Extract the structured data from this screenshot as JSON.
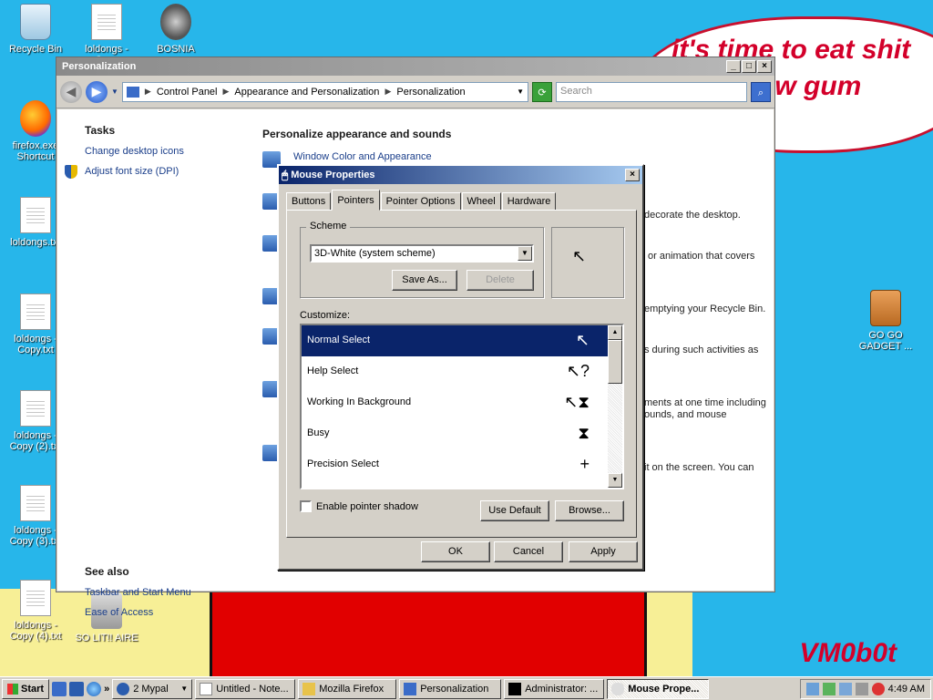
{
  "wallpaper": {
    "speech_text": "it's time to eat shit and chew gum",
    "signature": "VM0b0t"
  },
  "desktop_icons": [
    {
      "label": "Recycle Bin"
    },
    {
      "label": "loldongs - Copy"
    },
    {
      "label": "BOSNIA"
    },
    {
      "label": "firefox.exe Shortcut"
    },
    {
      "label": "loldongs.txt"
    },
    {
      "label": "loldongs - Copy.txt"
    },
    {
      "label": "loldongs - Copy (2).txt"
    },
    {
      "label": "loldongs - Copy (3).txt"
    },
    {
      "label": "loldongs - Copy (4).txt"
    },
    {
      "label": "SO LIT!! AIRE"
    },
    {
      "label": "GO GO GADGET ..."
    }
  ],
  "personalization": {
    "title": "Personalization",
    "breadcrumb": [
      "Control Panel",
      "Appearance and Personalization",
      "Personalization"
    ],
    "search_placeholder": "Search",
    "tasks_heading": "Tasks",
    "tasks": [
      "Change desktop icons",
      "Adjust font size (DPI)"
    ],
    "see_also_heading": "See also",
    "see_also": [
      "Taskbar and Start Menu",
      "Ease of Access"
    ],
    "main_heading": "Personalize appearance and sounds",
    "first_item": "Window Color and Appearance",
    "fragments": [
      "decorate the desktop.",
      "or animation that covers",
      "emptying your Recycle Bin.",
      "s during such activities as",
      "ments at one time including",
      "ounds, and mouse",
      "it on the screen. You can"
    ]
  },
  "mouse_dialog": {
    "title": "Mouse Properties",
    "tabs": [
      "Buttons",
      "Pointers",
      "Pointer Options",
      "Wheel",
      "Hardware"
    ],
    "scheme_label": "Scheme",
    "scheme_value": "3D-White (system scheme)",
    "save_as": "Save As...",
    "delete": "Delete",
    "customize_label": "Customize:",
    "pointers": [
      {
        "name": "Normal Select",
        "cursor": "↖"
      },
      {
        "name": "Help Select",
        "cursor": "↖?"
      },
      {
        "name": "Working In Background",
        "cursor": "↖⧗"
      },
      {
        "name": "Busy",
        "cursor": "⧗"
      },
      {
        "name": "Precision Select",
        "cursor": "+"
      }
    ],
    "shadow_label": "Enable pointer shadow",
    "use_default": "Use Default",
    "browse": "Browse...",
    "ok": "OK",
    "cancel": "Cancel",
    "apply": "Apply"
  },
  "taskbar": {
    "start": "Start",
    "buttons": [
      {
        "label": "2 Mypal"
      },
      {
        "label": "Untitled - Note..."
      },
      {
        "label": "Mozilla Firefox"
      },
      {
        "label": "Personalization"
      },
      {
        "label": "Administrator: ..."
      },
      {
        "label": "Mouse Prope..."
      }
    ],
    "clock": "4:49 AM"
  }
}
